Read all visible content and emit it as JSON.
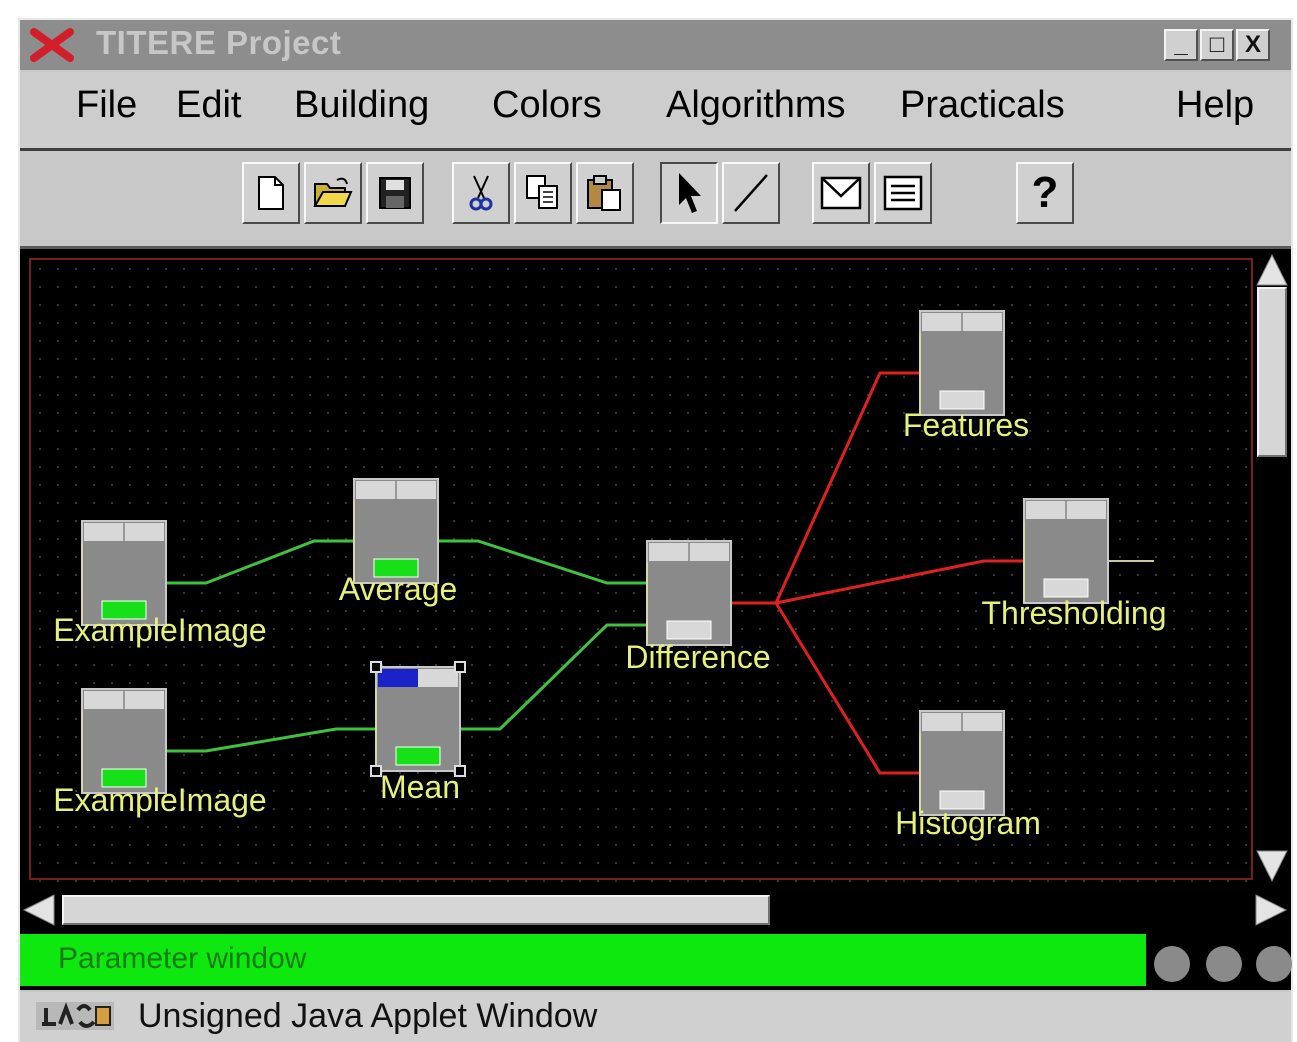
{
  "window": {
    "title": "TITERE Project",
    "controls": {
      "minimize": "_",
      "maximize": "□",
      "close": "X"
    }
  },
  "menubar": {
    "items": [
      "File",
      "Edit",
      "Building",
      "Colors",
      "Algorithms",
      "Practicals",
      "Help"
    ]
  },
  "toolbar": {
    "buttons": [
      {
        "icon": "new-file-icon"
      },
      {
        "icon": "open-folder-icon"
      },
      {
        "icon": "save-disk-icon"
      },
      {
        "icon": "cut-icon"
      },
      {
        "icon": "copy-icon"
      },
      {
        "icon": "paste-icon"
      },
      {
        "icon": "pointer-arrow-icon"
      },
      {
        "icon": "line-tool-icon"
      },
      {
        "icon": "envelope-icon"
      },
      {
        "icon": "list-icon"
      },
      {
        "icon": "help-icon",
        "label": "?"
      }
    ]
  },
  "graph": {
    "nodes": [
      {
        "id": "n1",
        "label": "ExampleImage",
        "indicator": "green"
      },
      {
        "id": "n2",
        "label": "ExampleImage",
        "indicator": "green"
      },
      {
        "id": "n3",
        "label": "Average",
        "indicator": "green"
      },
      {
        "id": "n4",
        "label": "Mean",
        "indicator": "green",
        "selected": true
      },
      {
        "id": "n5",
        "label": "Difference",
        "indicator": "grey"
      },
      {
        "id": "n6",
        "label": "Features",
        "indicator": "grey"
      },
      {
        "id": "n7",
        "label": "Thresholding",
        "indicator": "grey"
      },
      {
        "id": "n8",
        "label": "Histogram",
        "indicator": "grey"
      }
    ],
    "edges": [
      {
        "from": "n1",
        "to": "n3",
        "color": "#3fc23f"
      },
      {
        "from": "n2",
        "to": "n4",
        "color": "#3fc23f"
      },
      {
        "from": "n3",
        "to": "n5",
        "color": "#3fc23f"
      },
      {
        "from": "n4",
        "to": "n5",
        "color": "#3fc23f"
      },
      {
        "from": "n5",
        "to": "n6",
        "color": "#e02020"
      },
      {
        "from": "n5",
        "to": "n7",
        "color": "#e02020"
      },
      {
        "from": "n5",
        "to": "n8",
        "color": "#e02020"
      }
    ]
  },
  "status": {
    "parameter_window": "Parameter window"
  },
  "applet": {
    "icon": "java-icon",
    "label": "Unsigned Java Applet Window"
  },
  "colors": {
    "canvas_bg": "#000000",
    "label": "#e6f07a",
    "data_edge": "#3fc23f",
    "output_edge": "#e02020",
    "status_green": "#0fe80f"
  }
}
